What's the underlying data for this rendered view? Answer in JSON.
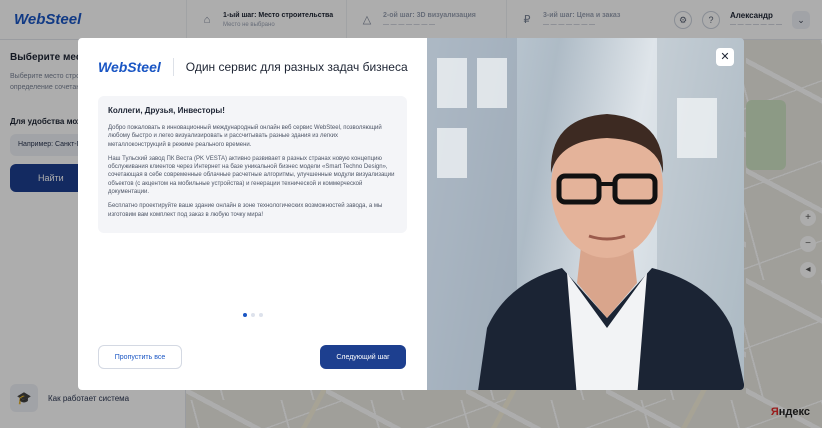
{
  "topbar": {
    "logo": "WebSteel",
    "steps": [
      {
        "icon": "building-icon",
        "title": "1-ый шаг: Место строительства",
        "sub": "Место не выбрано"
      },
      {
        "icon": "warning-icon",
        "title": "2-ой шаг: 3D визуализация",
        "sub": "— — — — — — —"
      },
      {
        "icon": "ruble-icon",
        "title": "3-ий шаг: Цена и заказ",
        "sub": "— — — — — — —"
      }
    ],
    "user_name": "Александр",
    "user_sub": "— — — — — — —"
  },
  "sidebar": {
    "title": "Выберите место",
    "desc_line1": "Выберите место стро",
    "desc_line2": "определение сочетан",
    "label": "Для удобства мож",
    "input_placeholder": "Например: Санкт-П",
    "button": "Найти",
    "how_label": "Как работает система"
  },
  "map": {
    "yandex_a": "Я",
    "yandex_b": "ндекс"
  },
  "modal": {
    "logo": "WebSteel",
    "title": "Один сервис для разных задач бизнеса",
    "greeting": "Коллеги, Друзья, Инвесторы!",
    "paragraphs": [
      "Добро пожаловать в инновационный международный онлайн веб сервис WebSteel, позволяющий любому быстро и легко визуализировать и рассчитывать разные здания из легких металлоконструкций в режиме реального времени.",
      "Наш Тульский завод ПК Веста (PK VESTA) активно развивает в разных странах новую концепцию обслуживания клиентов через Интернет на базе уникальной бизнес модели «Smart Techno Design», сочетающая в себе современные облачные расчетные алгоритмы, улучшенные модули визуализации объектов (с акцентом на мобильные устройства) и генерации технической и коммерческой документации.",
      "Бесплатно проектируйте ваше здание онлайн в зоне технологических возможностей завода, а мы изготовим вам комплект под заказ в любую точку мира!"
    ],
    "slides_total": 3,
    "slide_active": 1,
    "skip_label": "Пропустить все",
    "next_label": "Следующий шаг",
    "close_icon": "close-icon"
  },
  "colors": {
    "brand": "#1a56c4",
    "primary_button": "#1d3f8f"
  }
}
